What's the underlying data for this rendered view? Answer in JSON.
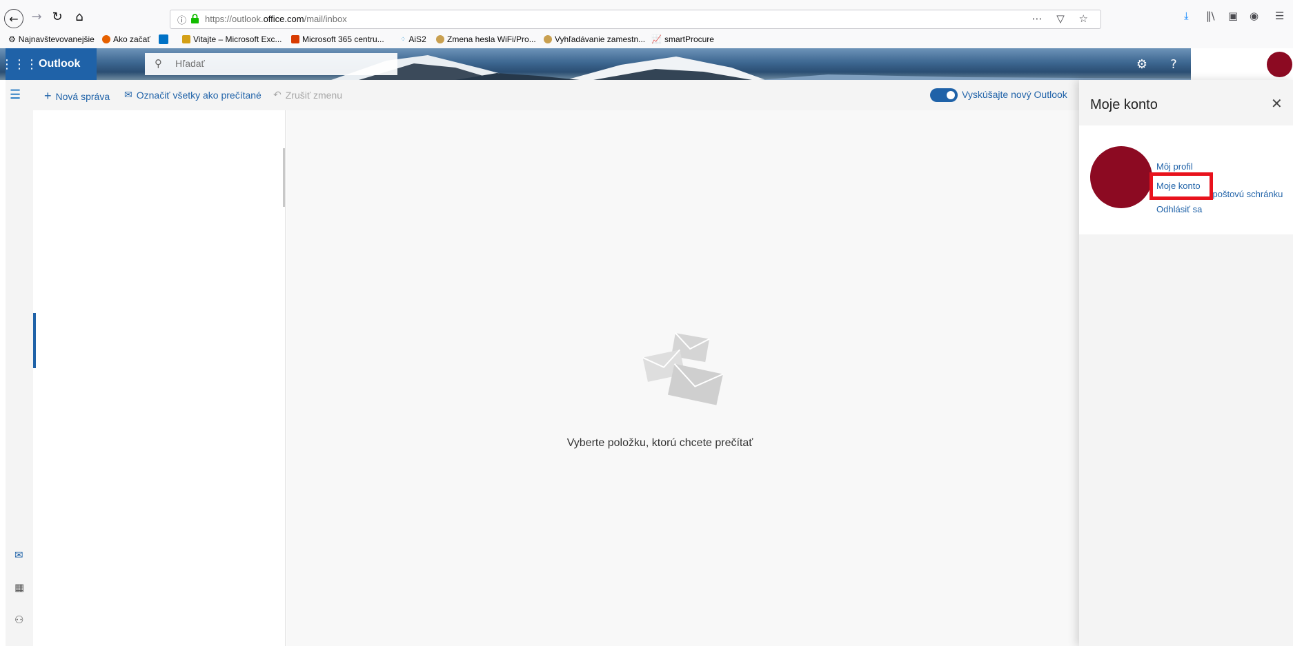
{
  "browser": {
    "url_prefix": "https://outlook.",
    "url_domain": "office.com",
    "url_path": "/mail/inbox",
    "bookmarks": [
      {
        "label": "Najnavštevovanejšie",
        "icon": "gear-icon"
      },
      {
        "label": "Ako začať",
        "icon": "firefox-icon"
      },
      {
        "label": "",
        "icon": "outlook-icon"
      },
      {
        "label": "Vitajte – Microsoft Exc...",
        "icon": "exchange-icon"
      },
      {
        "label": "Microsoft 365 centru...",
        "icon": "office-icon"
      },
      {
        "label": "AiS2",
        "icon": "ais-icon"
      },
      {
        "label": "Zmena hesla WiFi/Pro...",
        "icon": "globe-icon"
      },
      {
        "label": "Vyhľadávanie zamestn...",
        "icon": "globe-icon"
      },
      {
        "label": "smartProcure",
        "icon": "chart-icon"
      }
    ]
  },
  "header": {
    "brand": "Outlook",
    "search_placeholder": "Hľadať"
  },
  "commands": {
    "new_message": "Nová správa",
    "mark_all_read": "Označiť všetky ako prečítané",
    "undo": "Zrušiť zmenu",
    "try_new": "Vyskúšajte nový Outlook"
  },
  "reading": {
    "empty_message": "Vyberte položku, ktorú chcete prečítať"
  },
  "account_panel": {
    "title": "Moje konto",
    "links": {
      "my_profile": "Môj profil",
      "my_account": "Moje konto",
      "open_mailbox": "Otvoriť ďalšiu poštovú schránku",
      "sign_out": "Odhlásiť sa"
    }
  },
  "colors": {
    "accent": "#1f62a8",
    "avatar": "#8c0a22",
    "highlight": "#e8121c"
  }
}
